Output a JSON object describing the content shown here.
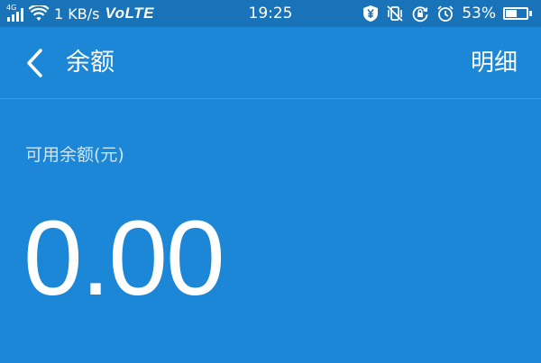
{
  "status_bar": {
    "network_type": "4G",
    "speed": "1 KB/s",
    "volte": "VoLTE",
    "time": "19:25",
    "battery_percent": "53%",
    "battery_level": 0.53,
    "icons": [
      "signal-icon",
      "wifi-icon",
      "shield-yen-icon",
      "vibrate-off-icon",
      "rotation-lock-icon",
      "alarm-icon",
      "battery-icon"
    ]
  },
  "header": {
    "title": "余额",
    "detail_label": "明细",
    "back_icon": "chevron-left-icon"
  },
  "balance": {
    "label": "可用余额(元)",
    "amount": "0.00"
  },
  "colors": {
    "background": "#1b87d6",
    "status_bar": "#1873b8",
    "text": "#ffffff"
  }
}
